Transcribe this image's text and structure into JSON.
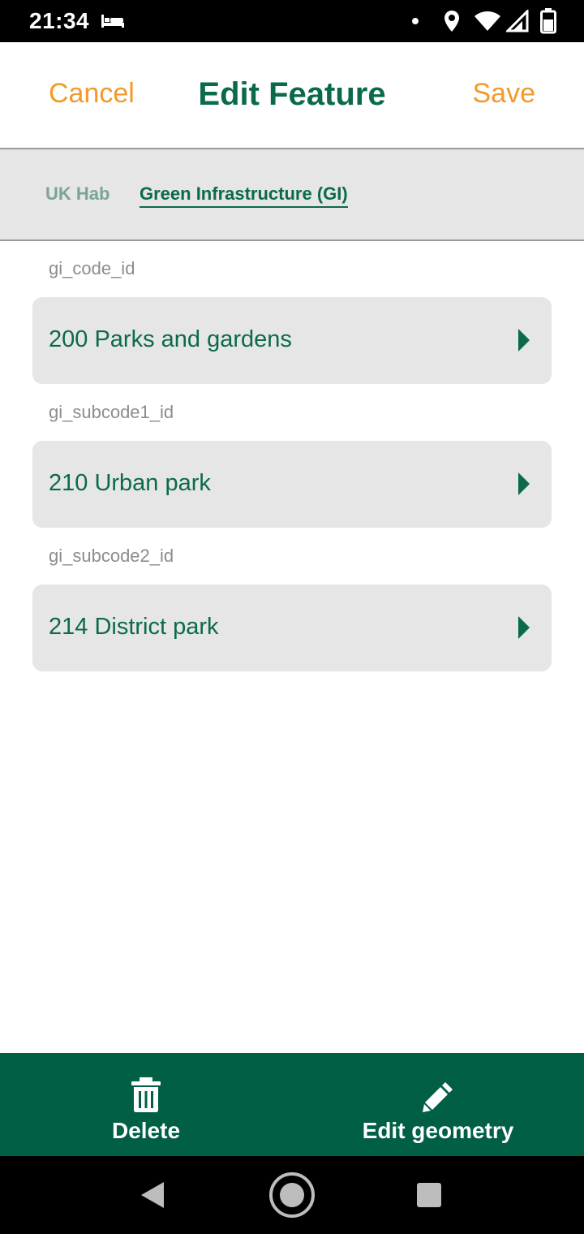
{
  "status_bar": {
    "time": "21:34",
    "icons": [
      "bed-icon",
      "dot-icon",
      "location-icon",
      "wifi-icon",
      "signal-icon",
      "battery-icon"
    ]
  },
  "header": {
    "cancel_label": "Cancel",
    "title": "Edit Feature",
    "save_label": "Save"
  },
  "tabs": [
    {
      "label": "UK Hab",
      "selected": false
    },
    {
      "label": "Green Infrastructure (GI)",
      "selected": true
    }
  ],
  "fields": [
    {
      "label": "gi_code_id",
      "value": "200 Parks and gardens"
    },
    {
      "label": "gi_subcode1_id",
      "value": "210 Urban park"
    },
    {
      "label": "gi_subcode2_id",
      "value": "214 District park"
    }
  ],
  "actions": {
    "delete_label": "Delete",
    "edit_geometry_label": "Edit geometry"
  },
  "nav": {
    "icons": [
      "back-icon",
      "home-icon",
      "recents-icon"
    ]
  },
  "colors": {
    "accent_orange": "#f39a2b",
    "primary_green": "#0b6a4c",
    "action_bar_green": "#015f45",
    "field_background": "#e6e6e6",
    "label_gray": "#8c8c8c"
  }
}
